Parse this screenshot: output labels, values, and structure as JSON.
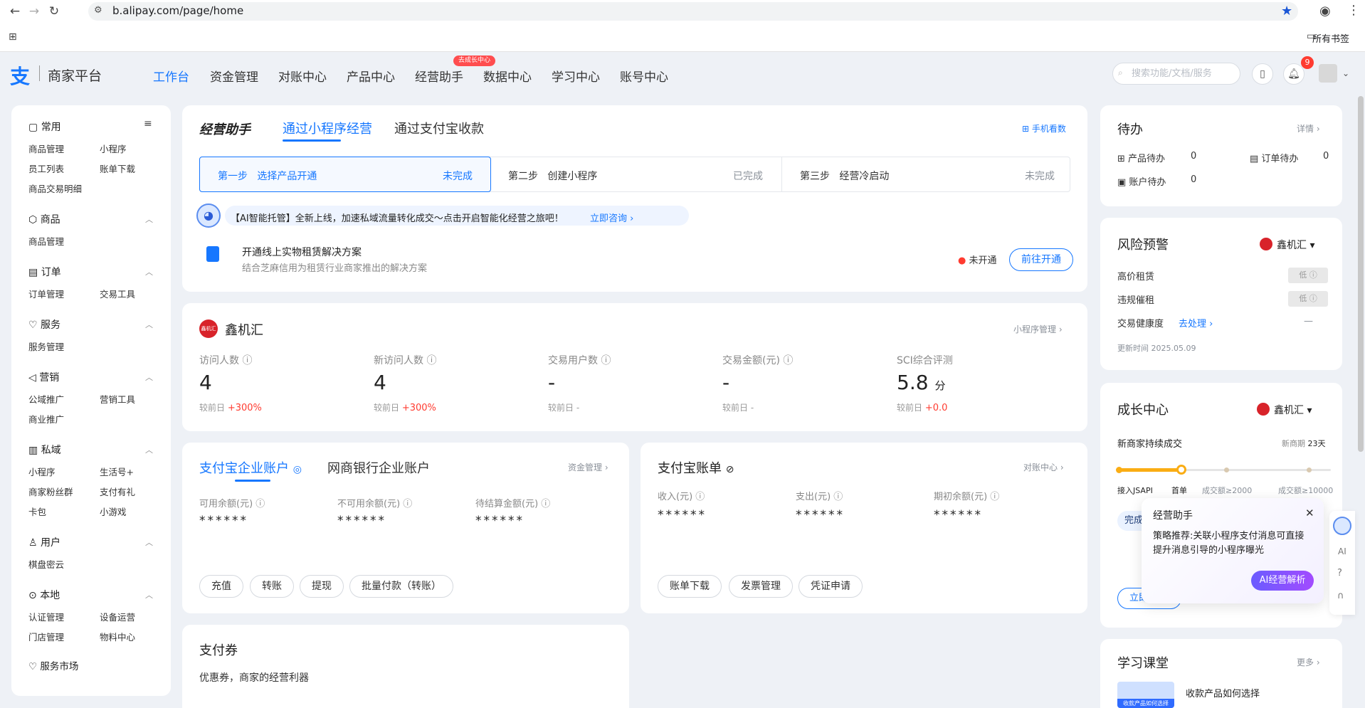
{
  "browser": {
    "url": "b.alipay.com/page/home",
    "bookmarks_label": "所有书签"
  },
  "app": {
    "logo_glyph": "支",
    "title": "商家平台",
    "nav": [
      {
        "label": "工作台"
      },
      {
        "label": "资金管理"
      },
      {
        "label": "对账中心"
      },
      {
        "label": "产品中心"
      },
      {
        "label": "经营助手"
      },
      {
        "label": "数据中心"
      },
      {
        "label": "学习中心"
      },
      {
        "label": "账号中心"
      }
    ],
    "nav_badge": "去成长中心",
    "search_placeholder": "搜索功能/文档/服务",
    "notification_count": "9"
  },
  "sidebar": {
    "sections": [
      {
        "title": "常用",
        "items": [
          "商品管理",
          "小程序",
          "员工列表",
          "账单下载",
          "商品交易明细"
        ]
      },
      {
        "title": "商品",
        "items": [
          "商品管理"
        ]
      },
      {
        "title": "订单",
        "items": [
          "订单管理",
          "交易工具"
        ]
      },
      {
        "title": "服务",
        "items": [
          "服务管理"
        ]
      },
      {
        "title": "营销",
        "items": [
          "公域推广",
          "营销工具",
          "商业推广"
        ]
      },
      {
        "title": "私域",
        "items": [
          "小程序",
          "生活号+",
          "商家粉丝群",
          "支付有礼",
          "卡包",
          "小游戏"
        ]
      },
      {
        "title": "用户",
        "items": [
          "棋盘密云"
        ]
      },
      {
        "title": "本地",
        "items": [
          "认证管理",
          "设备运营",
          "门店管理",
          "物料中心"
        ]
      },
      {
        "title": "服务市场",
        "items": []
      }
    ]
  },
  "assistant": {
    "title": "经营助手",
    "tabs": [
      "通过小程序经营",
      "通过支付宝收款"
    ],
    "mobile_view": "手机看数",
    "steps": [
      {
        "step": "第一步",
        "name": "选择产品开通",
        "status": "未完成"
      },
      {
        "step": "第二步",
        "name": "创建小程序",
        "status": "已完成"
      },
      {
        "step": "第三步",
        "name": "经营冷启动",
        "status": "未完成"
      }
    ],
    "ai_banner": "【AI智能托管】全新上线，加速私域流量转化成交～点击开启智能化经营之旅吧！",
    "ai_link": "立即咨询",
    "solution_title": "开通线上实物租赁解决方案",
    "solution_desc": "结合芝麻信用为租赁行业商家推出的解决方案",
    "solution_status": "未开通",
    "solution_btn": "前往开通"
  },
  "store": {
    "badge": "鑫机汇",
    "name": "鑫机汇",
    "manage_link": "小程序管理",
    "metrics": [
      {
        "label": "访问人数",
        "value": "4",
        "compare_label": "较前日",
        "compare": "+300%"
      },
      {
        "label": "新访问人数",
        "value": "4",
        "compare_label": "较前日",
        "compare": "+300%"
      },
      {
        "label": "交易用户数",
        "value": "-",
        "compare_label": "较前日",
        "compare": "-"
      },
      {
        "label": "交易金额(元)",
        "value": "-",
        "compare_label": "较前日",
        "compare": "-"
      },
      {
        "label": "SCI综合评测",
        "value": "5.8",
        "unit": "分",
        "compare_label": "较前日",
        "compare": "+0.0"
      }
    ]
  },
  "account": {
    "tabs": [
      "支付宝企业账户",
      "网商银行企业账户"
    ],
    "manage_link": "资金管理",
    "fields": [
      {
        "label": "可用余额(元)",
        "value": "******"
      },
      {
        "label": "不可用余额(元)",
        "value": "******"
      },
      {
        "label": "待结算金额(元)",
        "value": "******"
      }
    ],
    "actions": [
      "充值",
      "转账",
      "提现",
      "批量付款（转账）"
    ]
  },
  "bill": {
    "title": "支付宝账单",
    "link": "对账中心",
    "fields": [
      {
        "label": "收入(元)",
        "value": "******"
      },
      {
        "label": "支出(元)",
        "value": "******"
      },
      {
        "label": "期初余额(元)",
        "value": "******"
      }
    ],
    "actions": [
      "账单下载",
      "发票管理",
      "凭证申请"
    ]
  },
  "coupon": {
    "title": "支付券",
    "desc": "优惠券，商家的经营利器"
  },
  "todo": {
    "title": "待办",
    "detail": "详情",
    "items": [
      {
        "label": "产品待办",
        "count": "0"
      },
      {
        "label": "订单待办",
        "count": "0"
      },
      {
        "label": "账户待办",
        "count": "0"
      }
    ]
  },
  "risk": {
    "title": "风险预警",
    "store": "鑫机汇",
    "items": [
      {
        "label": "高价租赁",
        "status": "低"
      },
      {
        "label": "违规催租",
        "status": "低"
      },
      {
        "label": "交易健康度",
        "status": "—",
        "link": "去处理"
      }
    ],
    "updated": "更新时间 2025.05.09"
  },
  "growth": {
    "title": "成长中心",
    "store": "鑫机汇",
    "stage": "新商家持续成交",
    "stage_right": "新商期",
    "days": "23天",
    "progress_labels": [
      "接入JSAPI",
      "首单",
      "成交额≥2000",
      "成交额≥10000"
    ],
    "progress_fraction": 0.3,
    "tag": "完成",
    "btn": "立即"
  },
  "popup": {
    "title": "经营助手",
    "text": "策略推荐:关联小程序支付消息可直接提升消息引导的小程序曝光",
    "btn": "AI经营解析"
  },
  "learn": {
    "title": "学习课堂",
    "more": "更多",
    "item": "收款产品如何选择",
    "thumb_text": "收款产品如何选择"
  },
  "floatbar": {
    "ai": "AI"
  }
}
